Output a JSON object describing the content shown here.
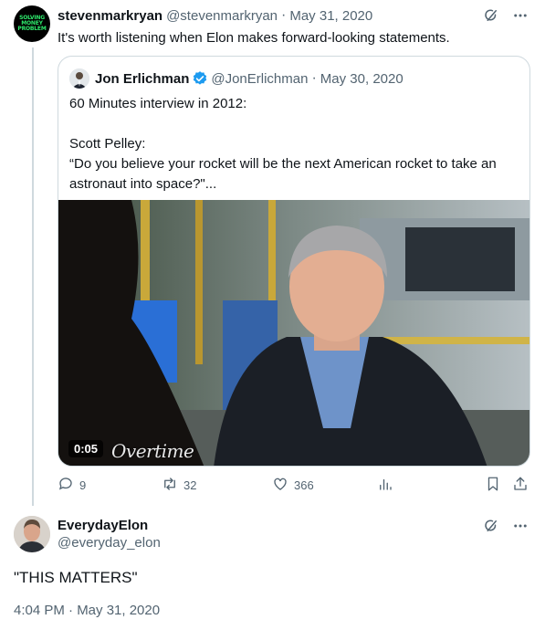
{
  "tweet": {
    "avatar_text": "SOLVING\nMONEY\nPROBLEM",
    "name": "stevenmarkryan",
    "handle": "@stevenmarkryan",
    "date": "May 31, 2020",
    "text": "It's worth listening when Elon makes forward-looking statements."
  },
  "quoted": {
    "name": "Jon Erlichman",
    "handle": "@JonErlichman",
    "date": "May 30, 2020",
    "text": "60 Minutes interview in 2012:\n\nScott Pelley:\n“Do you believe your rocket will be the next American rocket to take an astronaut into space?\"...",
    "video_time": "0:05",
    "watermark": "Overtime"
  },
  "actions": {
    "replies": "9",
    "reposts": "32",
    "likes": "366"
  },
  "reply": {
    "name": "EverydayElon",
    "handle": "@everyday_elon",
    "text": "\"THIS MATTERS\"",
    "timestamp": "4:04 PM · May 31, 2020"
  },
  "colors": {
    "verified": "#1d9bf0",
    "muted": "#536471",
    "border": "#cfd9de"
  }
}
